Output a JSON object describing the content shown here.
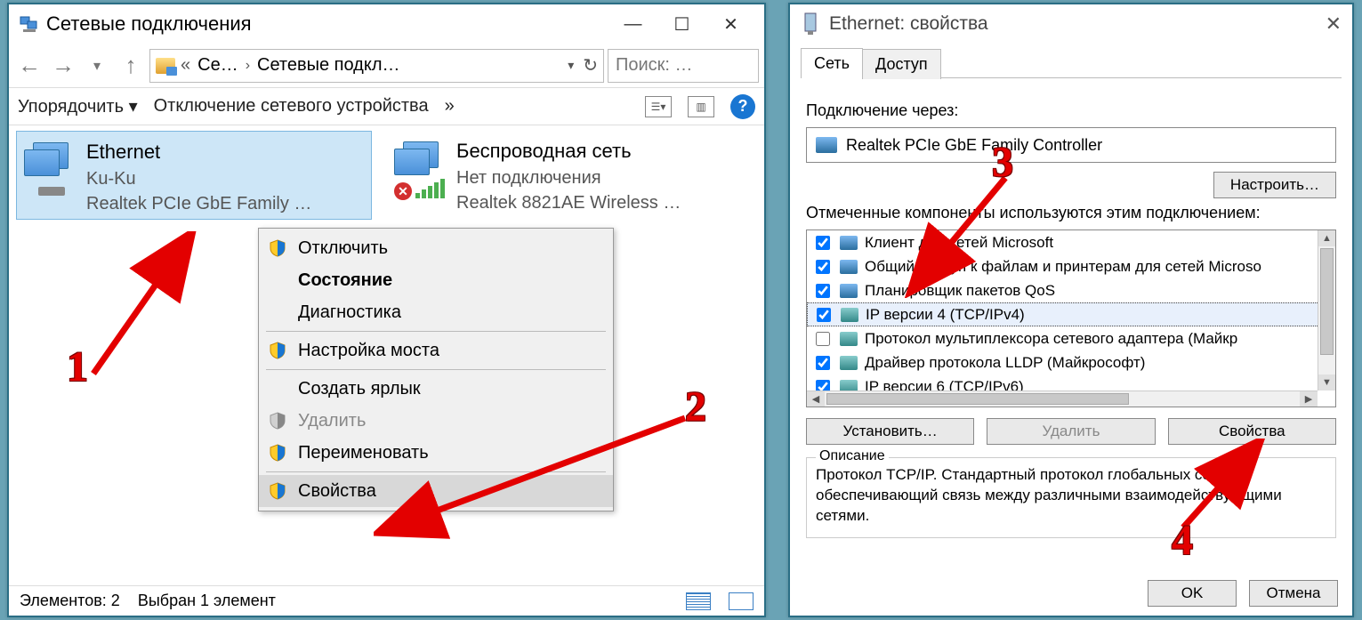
{
  "left": {
    "title": "Сетевые подключения",
    "nav_back": "←",
    "nav_fwd": "→",
    "nav_up": "↑",
    "crumb1": "Се…",
    "crumb2": "Сетевые подкл…",
    "search_placeholder": "Поиск: …",
    "toolbar": {
      "sort": "Упорядочить ▾",
      "disable": "Отключение сетевого устройства",
      "more": "»"
    },
    "items": [
      {
        "name": "Ethernet",
        "line2": "Ku-Ku",
        "line3": "Realtek PCIe GbE Family …"
      },
      {
        "name": "Беспроводная сеть",
        "line2": "Нет подключения",
        "line3": "Realtek 8821AE Wireless …"
      }
    ],
    "status": {
      "count": "Элементов: 2",
      "sel": "Выбран 1 элемент"
    },
    "ctx": {
      "disable": "Отключить",
      "status": "Состояние",
      "diag": "Диагностика",
      "bridge": "Настройка моста",
      "shortcut": "Создать ярлык",
      "delete": "Удалить",
      "rename": "Переименовать",
      "props": "Свойства"
    }
  },
  "right": {
    "title": "Ethernet: свойства",
    "tabs": {
      "net": "Сеть",
      "access": "Доступ"
    },
    "conn_lbl": "Подключение через:",
    "adapter": "Realtek PCIe GbE Family Controller",
    "configure": "Настроить…",
    "comp_lbl": "Отмеченные компоненты используются этим подключением:",
    "components": [
      {
        "checked": true,
        "label": "Клиент для сетей Microsoft"
      },
      {
        "checked": true,
        "label": "Общий доступ к файлам и принтерам для сетей Microso"
      },
      {
        "checked": true,
        "label": "Планировщик пакетов QoS"
      },
      {
        "checked": true,
        "label": "IP версии 4 (TCP/IPv4)",
        "selected": true
      },
      {
        "checked": false,
        "label": "Протокол мультиплексора сетевого адаптера (Майкр"
      },
      {
        "checked": true,
        "label": "Драйвер протокола LLDP (Майкрософт)"
      },
      {
        "checked": true,
        "label": "IP версии 6 (TCP/IPv6)"
      }
    ],
    "install": "Установить…",
    "remove": "Удалить",
    "props": "Свойства",
    "desc_lbl": "Описание",
    "desc": "Протокол TCP/IP. Стандартный протокол глобальных сетей, обеспечивающий связь между различными взаимодействующими сетями.",
    "ok": "OK",
    "cancel": "Отмена"
  },
  "annot": {
    "n1": "1",
    "n2": "2",
    "n3": "3",
    "n4": "4"
  }
}
